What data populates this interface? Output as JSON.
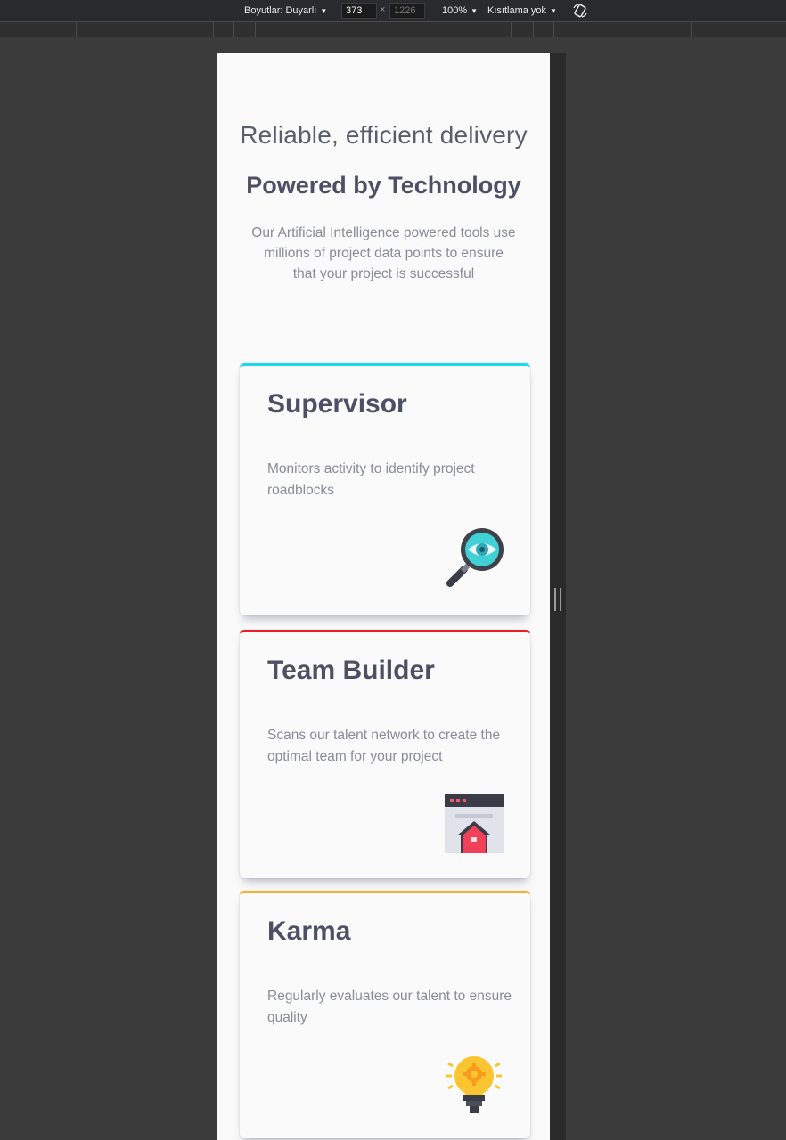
{
  "devtools": {
    "dimensions_label": "Boyutlar: Duyarlı",
    "width_value": "373",
    "height_placeholder": "1226",
    "times": "×",
    "zoom": "100%",
    "throttling": "Kısıtlama yok"
  },
  "page": {
    "subtitle": "Reliable, efficient delivery",
    "title": "Powered by Technology",
    "intro": "Our Artificial Intelligence powered tools use millions of project data points to ensure that your project is successful",
    "cards": [
      {
        "title": "Supervisor",
        "description": "Monitors activity to identify project roadblocks",
        "accent": "#1fd8e7",
        "icon": "magnifier-eye-icon"
      },
      {
        "title": "Team Builder",
        "description": "Scans our talent network to create the optimal team for your project",
        "accent": "#ea1f25",
        "icon": "browser-house-icon"
      },
      {
        "title": "Karma",
        "description": "Regularly evaluates our talent to ensure quality",
        "accent": "#f4b22e",
        "icon": "lightbulb-gear-icon"
      }
    ]
  }
}
